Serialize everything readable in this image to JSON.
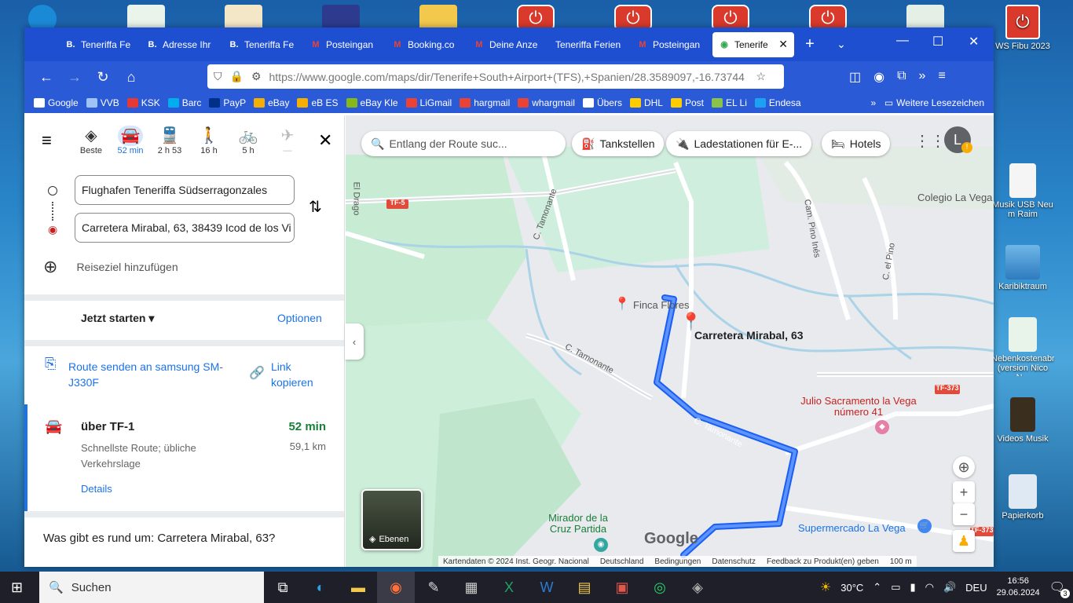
{
  "desktop": {
    "right_icons": [
      {
        "label": "WS Fibu 2023"
      },
      {
        "label": "Musik USB Neu m Raim"
      },
      {
        "label": "Karibiktraum"
      },
      {
        "label": "Nebenkostenabrech...2 (version Nico N..."
      },
      {
        "label": "Videos Musik"
      },
      {
        "label": "Papierkorb"
      }
    ]
  },
  "browser": {
    "tabs": [
      {
        "icon": "B.",
        "label": "Teneriffa Fe"
      },
      {
        "icon": "B.",
        "label": "Adresse Ihr"
      },
      {
        "icon": "B.",
        "label": "Teneriffa Fe"
      },
      {
        "icon": "M",
        "label": "Posteingan"
      },
      {
        "icon": "M",
        "label": "Booking.co"
      },
      {
        "icon": "M",
        "label": "Deine Anze"
      },
      {
        "icon": "",
        "label": "Teneriffa Ferien"
      },
      {
        "icon": "M",
        "label": "Posteingan"
      },
      {
        "icon": "◉",
        "label": "Tenerife",
        "active": true
      }
    ],
    "url": "https://www.google.com/maps/dir/Tenerife+South+Airport+(TFS),+Spanien/28.3589097,-16.73744",
    "bookmarks": [
      {
        "label": "Google",
        "color": "#ffffff"
      },
      {
        "label": "VVB",
        "color": "#9fc2f7"
      },
      {
        "label": "KSK",
        "color": "#e53935"
      },
      {
        "label": "Barc",
        "color": "#00aeef"
      },
      {
        "label": "PayP",
        "color": "#003087"
      },
      {
        "label": "eBay",
        "color": "#f5af02"
      },
      {
        "label": "eB ES",
        "color": "#f5af02"
      },
      {
        "label": "eBay Kle",
        "color": "#86b817"
      },
      {
        "label": "LiGmail",
        "color": "#ea4335"
      },
      {
        "label": "hargmail",
        "color": "#ea4335"
      },
      {
        "label": "whargmail",
        "color": "#ea4335"
      },
      {
        "label": "Übers",
        "color": "#ffffff"
      },
      {
        "label": "DHL",
        "color": "#ffcc00"
      },
      {
        "label": "Post",
        "color": "#ffcc00"
      },
      {
        "label": "EL Li",
        "color": "#8bc34a"
      },
      {
        "label": "Endesa",
        "color": "#1da1f2"
      }
    ],
    "more_bookmarks": "Weitere Lesezeichen"
  },
  "directions": {
    "modes": [
      {
        "name": "Beste",
        "icon": "◈"
      },
      {
        "name": "52 min",
        "icon": "🚘",
        "selected": true
      },
      {
        "name": "2 h 53",
        "icon": "🚆"
      },
      {
        "name": "16 h",
        "icon": "🚶"
      },
      {
        "name": "5 h",
        "icon": "🚲"
      },
      {
        "name": "—",
        "icon": "✈"
      }
    ],
    "origin": "Flughafen Teneriffa Südserragonzales",
    "destination": "Carretera Mirabal, 63, 38439 Icod de los Vi",
    "add_destination": "Reiseziel hinzufügen",
    "depart": "Jetzt starten",
    "options": "Optionen",
    "send_route": "Route senden an samsung SM-J330F",
    "copy_link": "Link kopieren",
    "route": {
      "via": "über TF-1",
      "duration": "52 min",
      "distance": "59,1 km",
      "note": "Schnellste Route; übliche Verkehrslage",
      "details": "Details"
    },
    "nearby": "Was gibt es rund um: Carretera Mirabal, 63?"
  },
  "map": {
    "search_placeholder": "Entlang der Route suc...",
    "chips": [
      "Tankstellen",
      "Ladestationen für E-...",
      "Hotels"
    ],
    "labels": {
      "dest": "Carretera Mirabal, 63",
      "finca": "Finca Flores",
      "julio": "Julio Sacramento la Vega número 41",
      "colegio": "Colegio La Vega",
      "mirador": "Mirador de la Cruz Partida",
      "super": "Supermercado La Vega",
      "tamonante1": "C. Tamonante",
      "tamonante2": "C. Tamonante",
      "tamonante3": "C. Tamonante",
      "eldrago": "El Drago",
      "tf5": "TF-5",
      "tf373": "TF-373",
      "tf373b": "TF-373",
      "campino": "Cam. Pino Inés",
      "elpino": "C. el Pino",
      "google": "Google",
      "layers": "Ebenen"
    },
    "footer": [
      "Kartendaten © 2024 Inst. Geogr. Nacional",
      "Deutschland",
      "Bedingungen",
      "Datenschutz",
      "Feedback zu Produkt(en) geben",
      "100 m"
    ],
    "avatar": "L"
  },
  "taskbar": {
    "search": "Suchen",
    "temperature": "30°C",
    "language": "DEU",
    "time": "16:56",
    "date": "29.06.2024",
    "notifications": "3"
  }
}
